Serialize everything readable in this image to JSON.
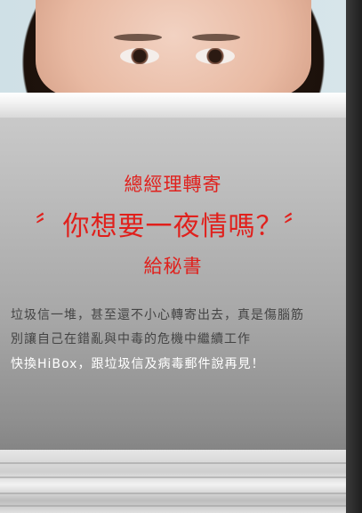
{
  "headline": {
    "line1": "總經理轉寄",
    "line2": "〞你想要一夜情嗎？〞",
    "line3": "給秘書"
  },
  "body": {
    "line1": "垃圾信一堆，甚至還不小心轉寄出去，真是傷腦筋",
    "line2": "別讓自己在錯亂與中毒的危機中繼續工作",
    "line3": "快換HiBox，跟垃圾信及病毒郵件說再見！"
  },
  "colors": {
    "headline": "#e0201c",
    "body_text": "#444444",
    "highlight_text": "#ffffff"
  }
}
